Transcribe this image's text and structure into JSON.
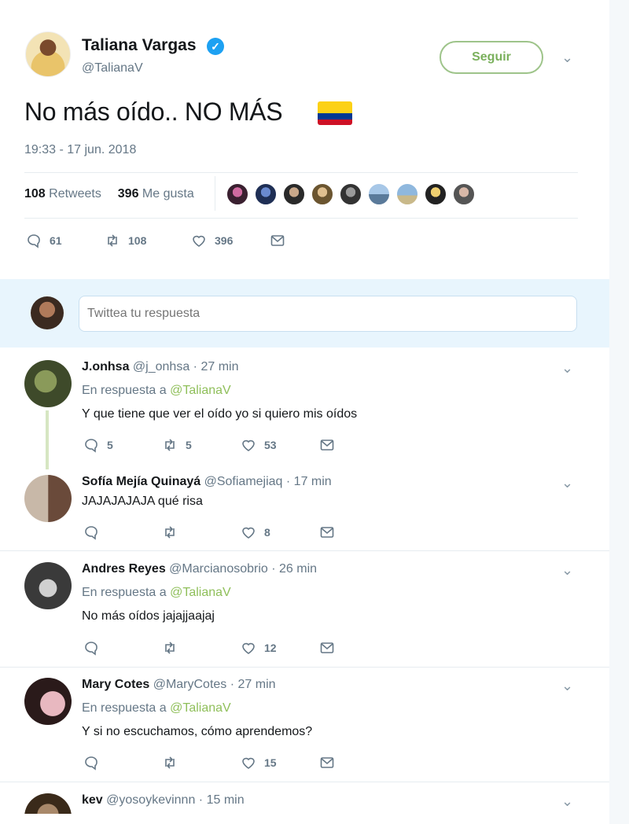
{
  "tweet": {
    "author_name": "Taliana Vargas",
    "author_handle": "@TalianaV",
    "follow_label": "Seguir",
    "text": "No más oído.. NO MÁS",
    "timestamp": "19:33 - 17 jun. 2018",
    "retweets_count": "108",
    "retweets_label": "Retweets",
    "likes_count": "396",
    "likes_label": "Me gusta",
    "actions": {
      "replies": "61",
      "retweets": "108",
      "likes": "396"
    }
  },
  "reply_box": {
    "placeholder": "Twittea tu respuesta"
  },
  "replies": [
    {
      "name": "J.onhsa",
      "handle": "@j_onhsa",
      "time": "· 27 min",
      "in_reply_label": "En respuesta a",
      "in_reply_mention": "@TalianaV",
      "text": "Y que tiene que ver el oído yo si quiero mis oídos",
      "replies": "5",
      "retweets": "5",
      "likes": "53"
    },
    {
      "name": "Sofía Mejía Quinayá",
      "handle": "@Sofiamejiaq",
      "time": "· 17 min",
      "text": "JAJAJAJAJA qué risa",
      "replies": "",
      "retweets": "",
      "likes": "8"
    },
    {
      "name": "Andres Reyes",
      "handle": "@Marcianosobrio",
      "time": "· 26 min",
      "in_reply_label": "En respuesta a",
      "in_reply_mention": "@TalianaV",
      "text": "No más oídos jajajjaajaj",
      "replies": "",
      "retweets": "",
      "likes": "12"
    },
    {
      "name": "Mary Cotes",
      "handle": "@MaryCotes",
      "time": "· 27 min",
      "in_reply_label": "En respuesta a",
      "in_reply_mention": "@TalianaV",
      "text": "Y si no escuchamos, cómo aprendemos?",
      "replies": "",
      "retweets": "",
      "likes": "15"
    },
    {
      "name": "kev",
      "handle": "@yosoykevinnn",
      "time": "· 15 min"
    }
  ],
  "colors": {
    "accent_blue": "#1da1f2",
    "follow_green": "#7ab05c",
    "mention_green": "#8fbf5a",
    "reply_bar_bg": "#e8f5fd"
  },
  "icons": [
    "verified-icon",
    "chevron-down-icon",
    "reply-icon",
    "retweet-icon",
    "like-icon",
    "message-icon",
    "colombia-flag-icon"
  ]
}
